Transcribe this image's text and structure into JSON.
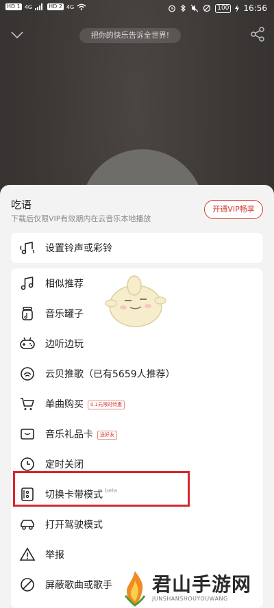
{
  "status_bar": {
    "hd1": "HD 1",
    "hd2": "HD 2",
    "sig1": "4G",
    "sig2": "4G",
    "battery": "100",
    "time": "16:56"
  },
  "header": {
    "placeholder": "把你的快乐告诉全世界!"
  },
  "sheet": {
    "title": "吃语",
    "subtitle": "下载后仅限VIP有效期内在云音乐本地播放",
    "vip_button": "开通VIP畅享"
  },
  "menu_top": [
    {
      "label": "设置铃声或彩铃",
      "icon": "ringtone-icon"
    }
  ],
  "menu": [
    {
      "label": "相似推荐",
      "icon": "music-note-icon"
    },
    {
      "label": "音乐罐子",
      "icon": "jar-icon"
    },
    {
      "label": "边听边玩",
      "icon": "gamepad-icon"
    },
    {
      "label": "云贝推歌（已有5659人推荐）",
      "icon": "cloud-coin-icon"
    },
    {
      "label": "单曲购买",
      "icon": "cart-icon",
      "tag": "0.1元限时特惠"
    },
    {
      "label": "音乐礼品卡",
      "icon": "gift-card-icon",
      "tag": "送好友"
    },
    {
      "label": "定时关闭",
      "icon": "clock-icon"
    },
    {
      "label": "切换卡带模式",
      "icon": "cassette-icon",
      "beta": "beta"
    },
    {
      "label": "打开驾驶模式",
      "icon": "car-icon"
    },
    {
      "label": "举报",
      "icon": "warning-icon"
    },
    {
      "label": "屏蔽歌曲或歌手",
      "icon": "block-icon"
    }
  ],
  "watermark": {
    "title": "君山手游网",
    "subtitle": "JUNSHANSHOUYOUWANG"
  },
  "colors": {
    "accent": "#d33a31",
    "highlight": "#d8272a",
    "sheet_bg": "#f3f3f3"
  }
}
